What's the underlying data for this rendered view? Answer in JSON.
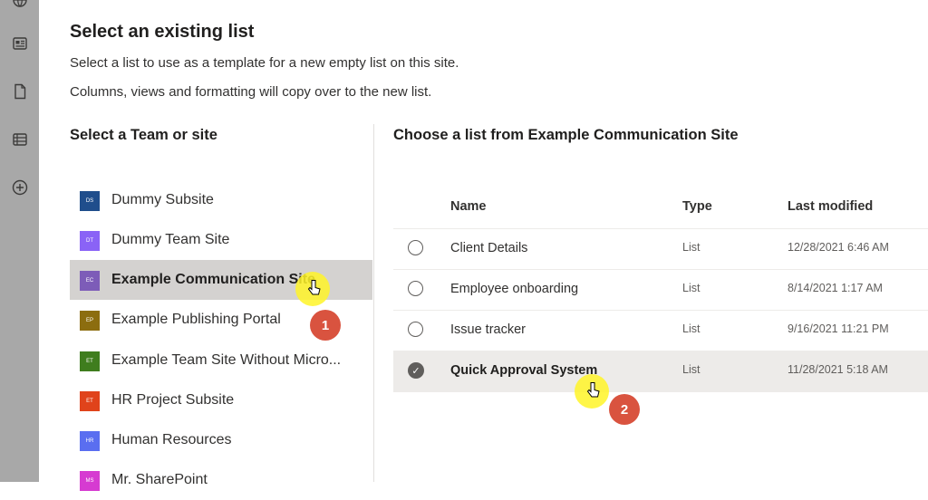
{
  "dialog": {
    "title": "Select an existing list",
    "desc1": "Select a list to use as a template for a new empty list on this site.",
    "desc2": "Columns, views and formatting will copy over to the new list."
  },
  "left": {
    "title": "Select a Team or site",
    "sites": [
      {
        "label": "Dummy Subsite",
        "initials": "DS",
        "color": "#1f4e8c",
        "selected": false
      },
      {
        "label": "Dummy Team Site",
        "initials": "DT",
        "color": "#8a63f6",
        "selected": false
      },
      {
        "label": "Example Communication Site",
        "initials": "EC",
        "color": "#7d5cb8",
        "selected": true
      },
      {
        "label": "Example Publishing Portal",
        "initials": "EP",
        "color": "#8c6d0f",
        "selected": false
      },
      {
        "label": "Example Team Site Without Micro...",
        "initials": "ET",
        "color": "#3f7d1e",
        "selected": false
      },
      {
        "label": "HR Project Subsite",
        "initials": "ET",
        "color": "#e0431b",
        "selected": false
      },
      {
        "label": "Human Resources",
        "initials": "HR",
        "color": "#5a6ef0",
        "selected": false
      },
      {
        "label": "Mr. SharePoint",
        "initials": "MS",
        "color": "#d63bd1",
        "selected": false
      }
    ]
  },
  "right": {
    "title": "Choose a list from Example Communication Site",
    "columns": {
      "name": "Name",
      "type": "Type",
      "modified": "Last modified"
    },
    "rows": [
      {
        "name": "Client Details",
        "type": "List",
        "modified": "12/28/2021 6:46 AM",
        "selected": false
      },
      {
        "name": "Employee onboarding",
        "type": "List",
        "modified": "8/14/2021 1:17 AM",
        "selected": false
      },
      {
        "name": "Issue tracker",
        "type": "List",
        "modified": "9/16/2021 11:21 PM",
        "selected": false
      },
      {
        "name": "Quick Approval System",
        "type": "List",
        "modified": "11/28/2021 5:18 AM",
        "selected": true
      }
    ]
  },
  "steps": [
    "1",
    "2"
  ],
  "rail_icons": [
    "globe-icon",
    "news-icon",
    "document-icon",
    "list-icon",
    "add-circle-icon"
  ]
}
